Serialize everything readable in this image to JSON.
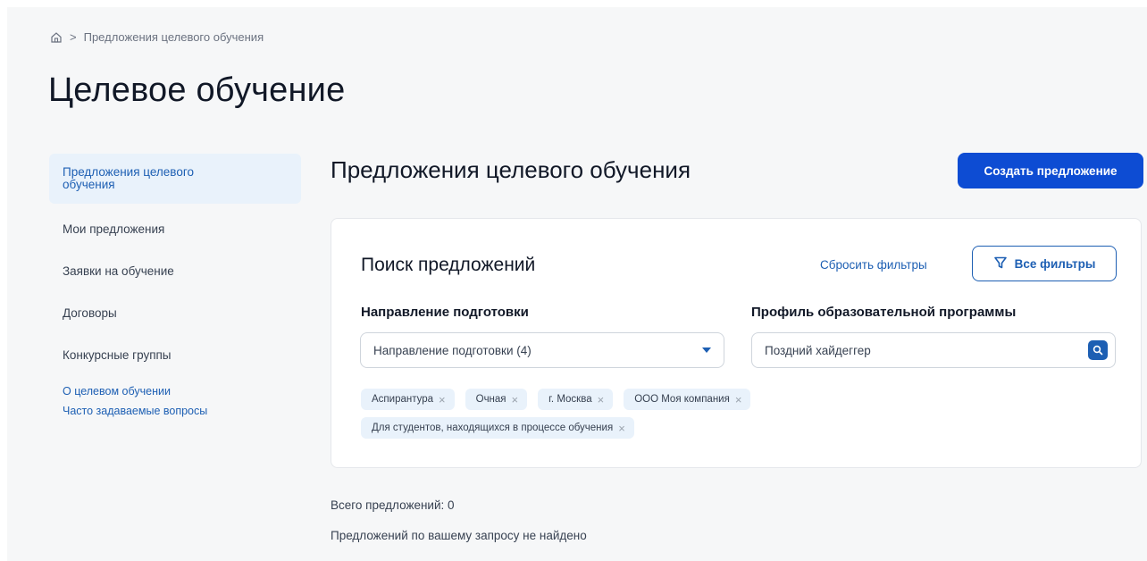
{
  "breadcrumb": {
    "home_icon": "home-icon",
    "separator": ">",
    "current": "Предложения целевого обучения"
  },
  "page_title": "Целевое обучение",
  "sidebar": {
    "items": [
      {
        "label": "Предложения целевого обучения",
        "active": true
      },
      {
        "label": "Мои предложения",
        "active": false
      },
      {
        "label": "Заявки на обучение",
        "active": false
      },
      {
        "label": "Договоры",
        "active": false
      },
      {
        "label": "Конкурсные группы",
        "active": false
      }
    ],
    "links": [
      {
        "label": "О целевом обучении"
      },
      {
        "label": "Часто задаваемые вопросы"
      }
    ]
  },
  "main": {
    "title": "Предложения целевого обучения",
    "create_button": "Создать предложение",
    "search_card": {
      "title": "Поиск предложений",
      "reset_label": "Сбросить фильтры",
      "filters_label": "Все фильтры",
      "filters_icon": "filter-icon",
      "direction_label": "Направление подготовки",
      "direction_value": "Направление подготовки (4)",
      "profile_label": "Профиль образовательной программы",
      "profile_value": "Поздний хайдеггер",
      "search_icon": "search-icon",
      "chips": [
        {
          "label": "Аспирантура"
        },
        {
          "label": "Очная"
        },
        {
          "label": "г. Москва"
        },
        {
          "label": "ООО Моя компания"
        },
        {
          "label": "Для студентов, находящихся в процессе обучения"
        }
      ],
      "chip_close": "×"
    },
    "total_text": "Всего предложений: 0",
    "empty_text": "Предложений по вашему запросу не найдено"
  },
  "colors": {
    "accent": "#1d5fb3",
    "button": "#0d4cd3",
    "active_bg": "#e9f2fb",
    "page_bg": "#f6f7f8"
  }
}
